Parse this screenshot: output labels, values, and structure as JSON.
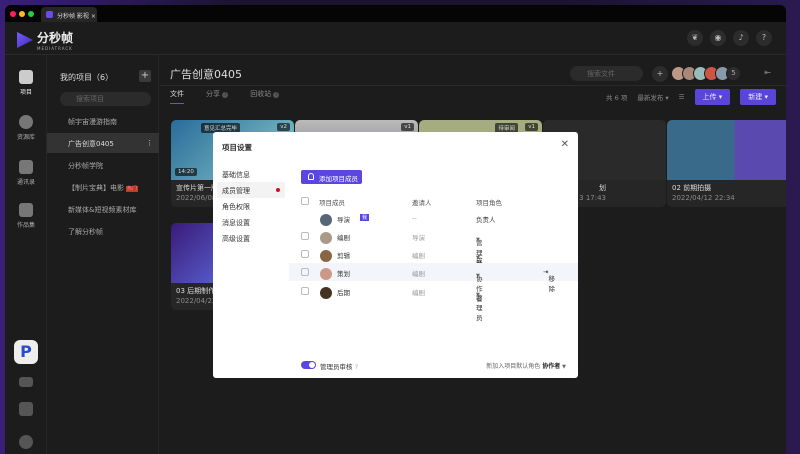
{
  "window": {
    "tab_title": "分秒帧 影视 ×"
  },
  "brand": {
    "name": "分秒帧",
    "sub": "MEDIATRACK"
  },
  "header_icons": [
    "leaf-icon",
    "chat-icon",
    "bell-icon",
    "help-icon"
  ],
  "rail": [
    {
      "label": "项目",
      "icon": "project-icon"
    },
    {
      "label": "资源库",
      "icon": "library-icon"
    },
    {
      "label": "通讯录",
      "icon": "contacts-icon"
    },
    {
      "label": "作品集",
      "icon": "portfolio-icon"
    }
  ],
  "projects": {
    "title": "我的项目（6）",
    "search_placeholder": "搜索项目",
    "items": [
      "帧宇宙漫游指南",
      "广告创意0405",
      "分秒帧学院",
      "【制片宝典】电影",
      "新媒体&短视频素材库",
      "了解分秒帧"
    ],
    "hot_badge": "热门"
  },
  "main": {
    "title": "广告创意0405",
    "tabs": [
      "文件",
      "分享",
      "回收站"
    ],
    "search_placeholder": "搜索文件",
    "member_count": "5",
    "total": "共 6 项",
    "sort": "最新发布",
    "upload": "上传",
    "new": "新建"
  },
  "cards": [
    {
      "title": "宣传片第一版",
      "date": "2022/06/08 1",
      "duration": "14:20",
      "status": "意见汇总完毕",
      "version": "v2"
    },
    {
      "title": "",
      "date": "",
      "version": "v1"
    },
    {
      "title": "",
      "date": "",
      "status": "待审阅",
      "version": "v1"
    },
    {
      "title": "划",
      "date": "3 17:43"
    },
    {
      "title": "02 前期拍摄",
      "date": "2022/04/12 22:34"
    },
    {
      "title": "03 后期制作",
      "date": "2022/04/22 1"
    }
  ],
  "modal": {
    "title": "项目设置",
    "nav": [
      "基础信息",
      "成员管理",
      "角色权限",
      "消息设置",
      "高级设置"
    ],
    "add_member": "添加项目成员",
    "columns": [
      "项目成员",
      "邀请人",
      "项目角色"
    ],
    "members": [
      {
        "name": "导演",
        "me": "我",
        "inviter": "--",
        "role": "负责人"
      },
      {
        "name": "编剧",
        "inviter": "导演",
        "role": "管理员"
      },
      {
        "name": "剪辑",
        "inviter": "编剧",
        "role": "成员"
      },
      {
        "name": "策划",
        "inviter": "编剧",
        "role": "协作者",
        "action": "移除"
      },
      {
        "name": "后期",
        "inviter": "编剧",
        "role": "管理员"
      }
    ],
    "admin_review": "管理员审核",
    "admin_review_on": true,
    "default_role_label": "新加入项目默认角色",
    "default_role": "协作者"
  },
  "colors": {
    "accent": "#5b47e0"
  }
}
